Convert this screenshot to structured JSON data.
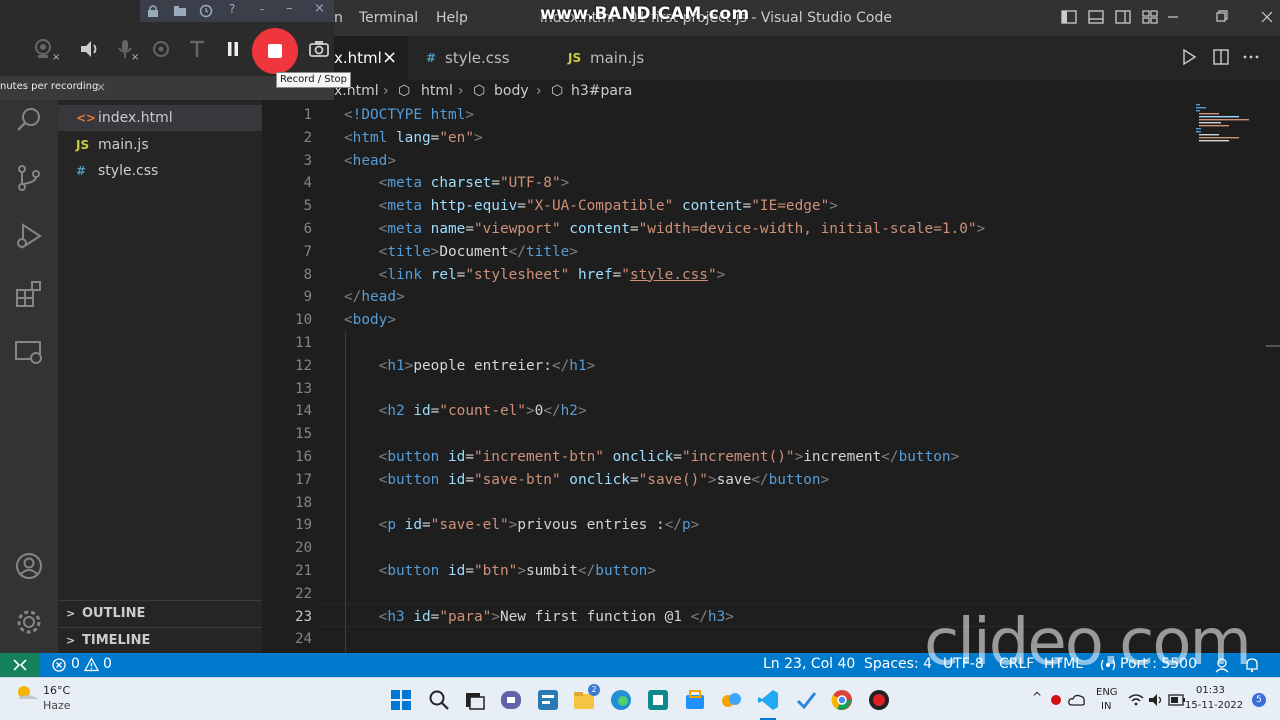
{
  "titlebar": {
    "menu": [
      "n",
      "Terminal",
      "Help"
    ],
    "title": "index.html - 01 first project js - Visual Studio Code",
    "watermark": "www.BANDICAM.com"
  },
  "tabs": [
    {
      "icon": "<>",
      "label": "index.html",
      "visible_label": "x.html",
      "active": true,
      "close": "×"
    },
    {
      "icon": "#",
      "label": "style.css",
      "active": false
    },
    {
      "icon": "JS",
      "label": "main.js",
      "active": false
    }
  ],
  "breadcrumb": [
    "x.html",
    "html",
    "body",
    "h3#para"
  ],
  "explorer": {
    "files": [
      {
        "icon": "<>",
        "name": "index.html",
        "color": "#e37933",
        "selected": true
      },
      {
        "icon": "JS",
        "name": "main.js",
        "color": "#cbcb41",
        "selected": false
      },
      {
        "icon": "#",
        "name": "style.css",
        "color": "#519aba",
        "selected": false
      }
    ],
    "sections": [
      "OUTLINE",
      "TIMELINE"
    ]
  },
  "editor": {
    "current_line": 23,
    "lines": [
      [
        [
          "punct",
          "<"
        ],
        [
          "tag",
          "!DOCTYPE"
        ],
        [
          "text",
          " "
        ],
        [
          "tag",
          "html"
        ],
        [
          "punct",
          ">"
        ]
      ],
      [
        [
          "punct",
          "<"
        ],
        [
          "tag",
          "html"
        ],
        [
          "text",
          " "
        ],
        [
          "attr",
          "lang"
        ],
        [
          "text",
          "="
        ],
        [
          "str",
          "\"en\""
        ],
        [
          "punct",
          ">"
        ]
      ],
      [
        [
          "punct",
          "<"
        ],
        [
          "tag",
          "head"
        ],
        [
          "punct",
          ">"
        ]
      ],
      [
        [
          "text",
          "    "
        ],
        [
          "punct",
          "<"
        ],
        [
          "tag",
          "meta"
        ],
        [
          "text",
          " "
        ],
        [
          "attr",
          "charset"
        ],
        [
          "text",
          "="
        ],
        [
          "str",
          "\"UTF-8\""
        ],
        [
          "punct",
          ">"
        ]
      ],
      [
        [
          "text",
          "    "
        ],
        [
          "punct",
          "<"
        ],
        [
          "tag",
          "meta"
        ],
        [
          "text",
          " "
        ],
        [
          "attr",
          "http-equiv"
        ],
        [
          "text",
          "="
        ],
        [
          "str",
          "\"X-UA-Compatible\""
        ],
        [
          "text",
          " "
        ],
        [
          "attr",
          "content"
        ],
        [
          "text",
          "="
        ],
        [
          "str",
          "\"IE=edge\""
        ],
        [
          "punct",
          ">"
        ]
      ],
      [
        [
          "text",
          "    "
        ],
        [
          "punct",
          "<"
        ],
        [
          "tag",
          "meta"
        ],
        [
          "text",
          " "
        ],
        [
          "attr",
          "name"
        ],
        [
          "text",
          "="
        ],
        [
          "str",
          "\"viewport\""
        ],
        [
          "text",
          " "
        ],
        [
          "attr",
          "content"
        ],
        [
          "text",
          "="
        ],
        [
          "str",
          "\"width=device-width, initial-scale=1.0\""
        ],
        [
          "punct",
          ">"
        ]
      ],
      [
        [
          "text",
          "    "
        ],
        [
          "punct",
          "<"
        ],
        [
          "tag",
          "title"
        ],
        [
          "punct",
          ">"
        ],
        [
          "text",
          "Document"
        ],
        [
          "punct",
          "</"
        ],
        [
          "tag",
          "title"
        ],
        [
          "punct",
          ">"
        ]
      ],
      [
        [
          "text",
          "    "
        ],
        [
          "punct",
          "<"
        ],
        [
          "tag",
          "link"
        ],
        [
          "text",
          " "
        ],
        [
          "attr",
          "rel"
        ],
        [
          "text",
          "="
        ],
        [
          "str",
          "\"stylesheet\""
        ],
        [
          "text",
          " "
        ],
        [
          "attr",
          "href"
        ],
        [
          "text",
          "="
        ],
        [
          "str",
          "\""
        ],
        [
          "link",
          "style.css"
        ],
        [
          "str",
          "\""
        ],
        [
          "punct",
          ">"
        ]
      ],
      [
        [
          "punct",
          "</"
        ],
        [
          "tag",
          "head"
        ],
        [
          "punct",
          ">"
        ]
      ],
      [
        [
          "punct",
          "<"
        ],
        [
          "tag",
          "body"
        ],
        [
          "punct",
          ">"
        ]
      ],
      [
        [
          "text",
          ""
        ]
      ],
      [
        [
          "text",
          "    "
        ],
        [
          "punct",
          "<"
        ],
        [
          "tag",
          "h1"
        ],
        [
          "punct",
          ">"
        ],
        [
          "text",
          "people entreier:"
        ],
        [
          "punct",
          "</"
        ],
        [
          "tag",
          "h1"
        ],
        [
          "punct",
          ">"
        ]
      ],
      [
        [
          "text",
          ""
        ]
      ],
      [
        [
          "text",
          "    "
        ],
        [
          "punct",
          "<"
        ],
        [
          "tag",
          "h2"
        ],
        [
          "text",
          " "
        ],
        [
          "attr",
          "id"
        ],
        [
          "text",
          "="
        ],
        [
          "str",
          "\"count-el\""
        ],
        [
          "punct",
          ">"
        ],
        [
          "text",
          "0"
        ],
        [
          "punct",
          "</"
        ],
        [
          "tag",
          "h2"
        ],
        [
          "punct",
          ">"
        ]
      ],
      [
        [
          "text",
          ""
        ]
      ],
      [
        [
          "text",
          "    "
        ],
        [
          "punct",
          "<"
        ],
        [
          "tag",
          "button"
        ],
        [
          "text",
          " "
        ],
        [
          "attr",
          "id"
        ],
        [
          "text",
          "="
        ],
        [
          "str",
          "\"increment-btn\""
        ],
        [
          "text",
          " "
        ],
        [
          "attr",
          "onclick"
        ],
        [
          "text",
          "="
        ],
        [
          "str",
          "\"increment()\""
        ],
        [
          "punct",
          ">"
        ],
        [
          "text",
          "increment"
        ],
        [
          "punct",
          "</"
        ],
        [
          "tag",
          "button"
        ],
        [
          "punct",
          ">"
        ]
      ],
      [
        [
          "text",
          "    "
        ],
        [
          "punct",
          "<"
        ],
        [
          "tag",
          "button"
        ],
        [
          "text",
          " "
        ],
        [
          "attr",
          "id"
        ],
        [
          "text",
          "="
        ],
        [
          "str",
          "\"save-btn\""
        ],
        [
          "text",
          " "
        ],
        [
          "attr",
          "onclick"
        ],
        [
          "text",
          "="
        ],
        [
          "str",
          "\"save()\""
        ],
        [
          "punct",
          ">"
        ],
        [
          "text",
          "save"
        ],
        [
          "punct",
          "</"
        ],
        [
          "tag",
          "button"
        ],
        [
          "punct",
          ">"
        ]
      ],
      [
        [
          "text",
          ""
        ]
      ],
      [
        [
          "text",
          "    "
        ],
        [
          "punct",
          "<"
        ],
        [
          "tag",
          "p"
        ],
        [
          "text",
          " "
        ],
        [
          "attr",
          "id"
        ],
        [
          "text",
          "="
        ],
        [
          "str",
          "\"save-el\""
        ],
        [
          "punct",
          ">"
        ],
        [
          "text",
          "privous entries :"
        ],
        [
          "punct",
          "</"
        ],
        [
          "tag",
          "p"
        ],
        [
          "punct",
          ">"
        ]
      ],
      [
        [
          "text",
          ""
        ]
      ],
      [
        [
          "text",
          "    "
        ],
        [
          "punct",
          "<"
        ],
        [
          "tag",
          "button"
        ],
        [
          "text",
          " "
        ],
        [
          "attr",
          "id"
        ],
        [
          "text",
          "="
        ],
        [
          "str",
          "\"btn\""
        ],
        [
          "punct",
          ">"
        ],
        [
          "text",
          "sumbit"
        ],
        [
          "punct",
          "</"
        ],
        [
          "tag",
          "button"
        ],
        [
          "punct",
          ">"
        ]
      ],
      [
        [
          "text",
          ""
        ]
      ],
      [
        [
          "text",
          "    "
        ],
        [
          "punct",
          "<"
        ],
        [
          "tag",
          "h3"
        ],
        [
          "text",
          " "
        ],
        [
          "attr",
          "id"
        ],
        [
          "text",
          "="
        ],
        [
          "str",
          "\"para\""
        ],
        [
          "punct",
          ">"
        ],
        [
          "text",
          "New first function @1 "
        ],
        [
          "punct",
          "</"
        ],
        [
          "tag",
          "h3"
        ],
        [
          "punct",
          ">"
        ]
      ],
      [
        [
          "text",
          ""
        ]
      ]
    ]
  },
  "statusbar": {
    "errors": "0",
    "warnings": "0",
    "position": "Ln 23, Col 40",
    "spaces": "Spaces: 4",
    "encoding": "UTF-8",
    "eol": "CRLF",
    "language": "HTML",
    "port": "Port : 5500",
    "watermark": "clideo.com"
  },
  "taskbar": {
    "weather_temp": "16°C",
    "weather_desc": "Haze",
    "lang": "ENG",
    "region": "IN",
    "time": "01:33",
    "date": "15-11-2022",
    "badge_chat": "2",
    "notif_count": "5"
  },
  "bandicam": {
    "notice": "nutes per recording.",
    "tooltip": "Record / Stop"
  },
  "colors": {
    "accent": "#007acc",
    "record": "#f0363d"
  }
}
